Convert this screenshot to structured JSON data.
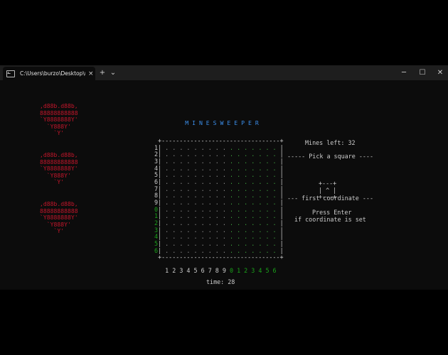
{
  "window": {
    "tab_title": "C:\\Users\\burzo\\Desktop\\mine",
    "tab_close": "×",
    "new_tab": "+",
    "dropdown": "⌄",
    "minimize": "─",
    "maximize": "☐",
    "close": "✕"
  },
  "game": {
    "title": "M I N E S W E E P E R",
    "hearts": [
      ",d88b.d88b,\n88888888888\n`Y8888888Y'\n  `Y888Y'\n    `Y'",
      ",d88b.d88b,\n88888888888\n`Y8888888Y'\n  `Y888Y'\n    `Y'",
      ",d88b.d88b,\n88888888888\n`Y8888888Y'\n  `Y888Y'\n    `Y'"
    ],
    "board": {
      "rows": 16,
      "cols": 16,
      "row_labels": [
        "1",
        "2",
        "3",
        "4",
        "5",
        "6",
        "7",
        "8",
        "9",
        "0",
        "1",
        "2",
        "3",
        "4",
        "5",
        "6"
      ],
      "col_labels": [
        "1",
        "2",
        "3",
        "4",
        "5",
        "6",
        "7",
        "8",
        "9",
        "0",
        "1",
        "2",
        "3",
        "4",
        "5",
        "6"
      ],
      "hidden_cell": ".",
      "cursor": null
    },
    "mines_left": "Mines left: 32",
    "pick_label": "----- Pick a square ----",
    "picker_box": "+---+\n| ^ |\n+---+",
    "coordinate_label": "--- first coordinate ---",
    "hint_line1": "Press Enter",
    "hint_line2": "if coordinate is set",
    "time": "time: 28"
  },
  "colors": {
    "title": "#3b8eea",
    "hearts": "#c3162b",
    "second_digits": "#1aa31a",
    "text": "#cccccc",
    "background": "#0c0c0c"
  }
}
